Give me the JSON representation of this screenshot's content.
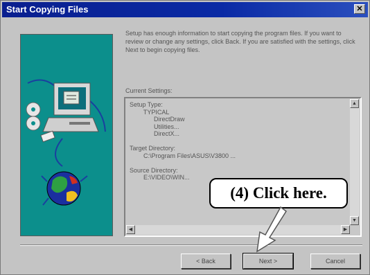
{
  "window": {
    "title": "Start Copying Files",
    "close_glyph": "✕"
  },
  "description": "Setup has enough information to start copying the program files. If you want to review or change any settings, click Back. If you are satisfied with the settings, click Next to begin copying files.",
  "current_settings": {
    "label": "Current Settings:",
    "lines": [
      "Setup Type:",
      "        TYPICAL",
      "              DirectDraw",
      "              Utilities...",
      "              DirectX...",
      "",
      "Target Directory:",
      "        C:\\Program Files\\ASUS\\V3800 ...",
      "",
      "Source Directory:",
      "        E:\\VIDEO\\WIN..."
    ]
  },
  "buttons": {
    "back": "< Back",
    "next": "Next >",
    "cancel": "Cancel"
  },
  "callout": {
    "text": "(4)  Click here."
  },
  "colors": {
    "titlebar": "#0a1f8f",
    "art_background": "#0c8f8c",
    "window_background": "#c4c4c4"
  }
}
